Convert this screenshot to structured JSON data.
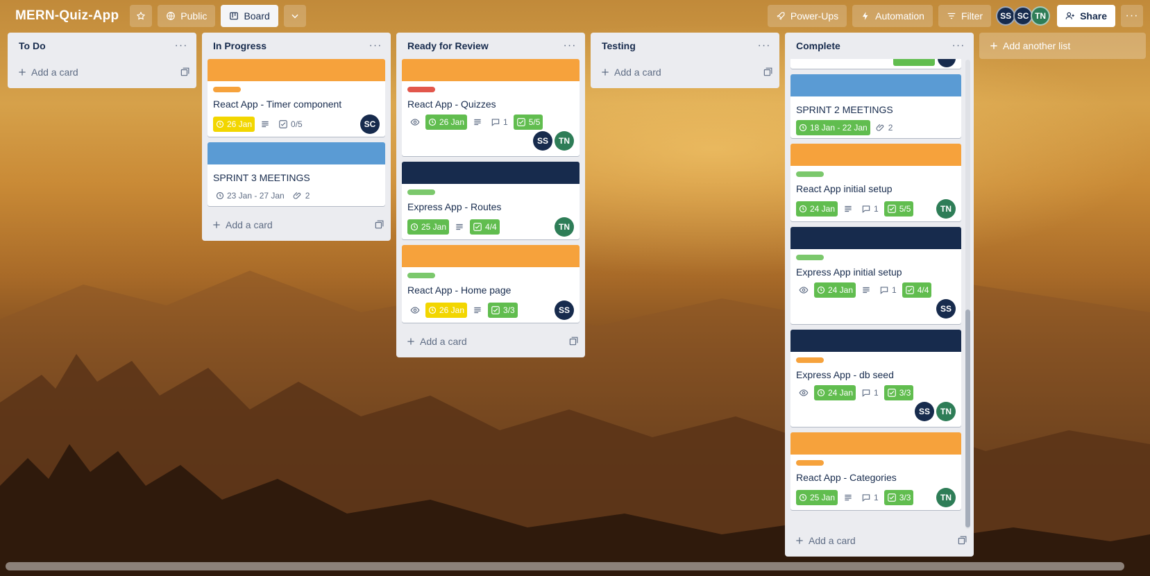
{
  "board": {
    "title": "MERN-Quiz-App",
    "visibility_label": "Public",
    "view_label": "Board",
    "powerups_label": "Power-Ups",
    "automation_label": "Automation",
    "filter_label": "Filter",
    "share_label": "Share",
    "members": [
      "SS",
      "SC",
      "TN"
    ]
  },
  "lists": {
    "todo": {
      "title": "To Do",
      "add_card": "Add a card"
    },
    "inprogress": {
      "title": "In Progress",
      "add_card": "Add a card",
      "cards": [
        {
          "title": "React App - Timer component",
          "cover": "#f6a23c",
          "label": "#f6a23c",
          "due": "26 Jan",
          "checklist": "0/5",
          "members": [
            "SC"
          ]
        },
        {
          "title": "SPRINT 3 MEETINGS",
          "cover": "#5a9bd4",
          "dates": "23 Jan - 27 Jan",
          "attachments": "2"
        }
      ]
    },
    "review": {
      "title": "Ready for Review",
      "add_card": "Add a card",
      "cards": [
        {
          "title": "React App - Quizzes",
          "cover": "#f6a23c",
          "label": "#e2574c",
          "due": "26 Jan",
          "comments": "1",
          "checklist": "5/5",
          "members": [
            "SS",
            "TN"
          ]
        },
        {
          "title": "Express App - Routes",
          "cover": "#172b4d",
          "label": "#7bc86c",
          "due": "25 Jan",
          "checklist": "4/4",
          "members": [
            "TN"
          ]
        },
        {
          "title": "React App - Home page",
          "cover": "#f6a23c",
          "label": "#7bc86c",
          "due": "26 Jan",
          "checklist": "3/3",
          "members": [
            "SS"
          ]
        }
      ]
    },
    "testing": {
      "title": "Testing",
      "add_card": "Add a card"
    },
    "complete": {
      "title": "Complete",
      "add_card": "Add a card",
      "cards": [
        {
          "title": "SPRINT 2 MEETINGS",
          "cover": "#5a9bd4",
          "dates": "18 Jan - 22 Jan",
          "attachments": "2"
        },
        {
          "title": "React App initial setup",
          "cover": "#f6a23c",
          "label": "#7bc86c",
          "due": "24 Jan",
          "comments": "1",
          "checklist": "5/5",
          "members": [
            "TN"
          ]
        },
        {
          "title": "Express App initial setup",
          "cover": "#172b4d",
          "label": "#7bc86c",
          "due": "24 Jan",
          "comments": "1",
          "checklist": "4/4",
          "members": [
            "SS"
          ]
        },
        {
          "title": "Express App - db seed",
          "cover": "#172b4d",
          "label": "#f6a23c",
          "due": "24 Jan",
          "comments": "1",
          "checklist": "3/3",
          "members": [
            "SS",
            "TN"
          ]
        },
        {
          "title": "React App - Categories",
          "cover": "#f6a23c",
          "label": "#f6a23c",
          "due": "25 Jan",
          "comments": "1",
          "checklist": "3/3",
          "members": [
            "TN"
          ]
        }
      ]
    }
  },
  "add_list_label": "Add another list",
  "colors": {
    "orange": "#f6a23c",
    "blue": "#5a9bd4",
    "navy": "#172b4d",
    "green_label": "#7bc86c",
    "red_label": "#e2574c",
    "due_complete": "#61bd4f",
    "due_soon": "#f2d600"
  }
}
